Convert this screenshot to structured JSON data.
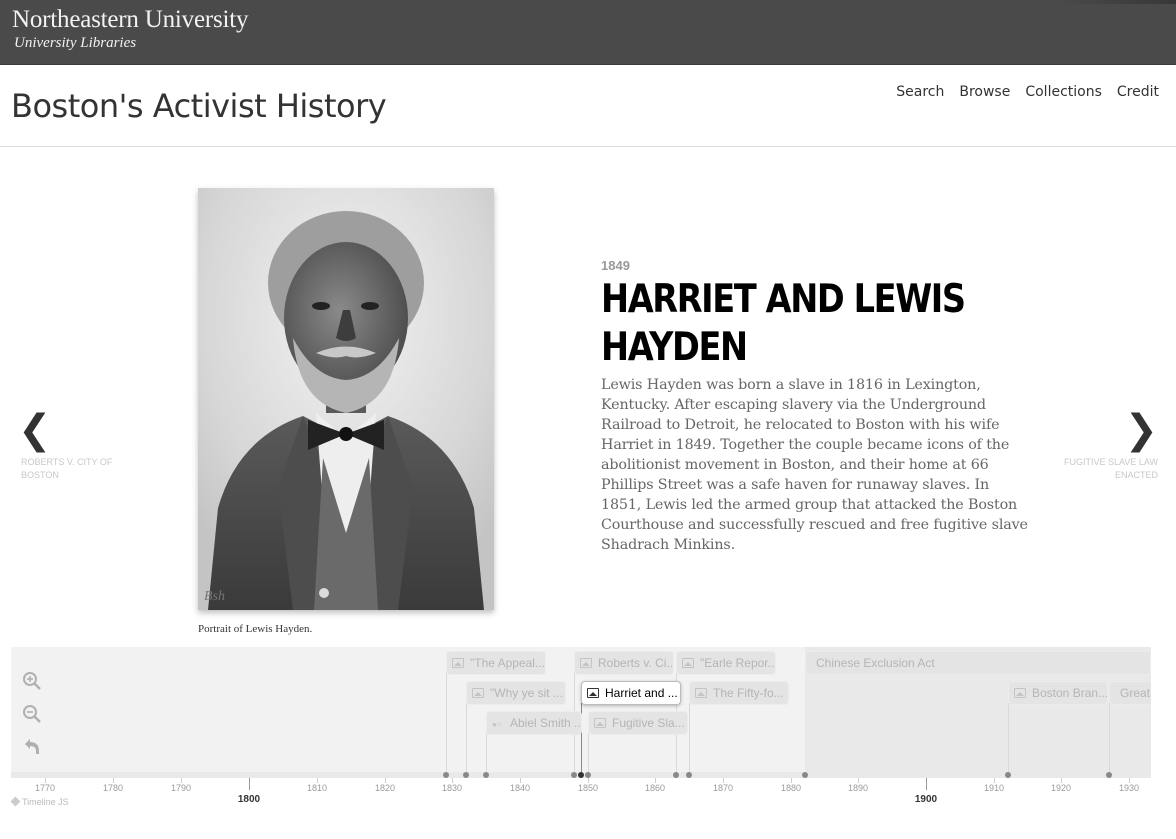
{
  "banner": {
    "university": "Northeastern University",
    "libraries": "University Libraries"
  },
  "header": {
    "site_title": "Boston's Activist History",
    "nav": [
      "Search",
      "Browse",
      "Collections",
      "Credit"
    ]
  },
  "slide": {
    "caption": "Portrait of Lewis Hayden.",
    "date": "1849",
    "headline": "Harriet and Lewis Hayden",
    "text": "Lewis Hayden was born a slave in 1816 in Lexington, Kentucky. After escaping slavery via the Underground Railroad to Detroit, he relocated to Boston with his wife Harriet in 1849. Together the couple became icons of the abolitionist movement in Boston, and their home at 66 Phillips Street was a safe haven for runaway slaves. In 1851, Lewis led the armed group that attacked the Boston Courthouse and successfully rescued and free fugitive slave Shadrach Minkins.",
    "prev_label": "Roberts v. City of Boston",
    "next_label": "Fugitive Slave Law Enacted"
  },
  "timeline": {
    "markers": [
      {
        "title": "\"The Appeal...",
        "icon": "image-icon",
        "active": false
      },
      {
        "title": "\"Why ye sit ...",
        "icon": "image-icon",
        "active": false
      },
      {
        "title": "Abiel Smith ...",
        "icon": "dots-icon",
        "active": false
      },
      {
        "title": "Roberts v. Ci...",
        "icon": "image-icon",
        "active": false
      },
      {
        "title": "Harriet and ...",
        "icon": "image-icon",
        "active": true
      },
      {
        "title": "Fugitive Sla...",
        "icon": "image-icon",
        "active": false
      },
      {
        "title": "\"Earle Repor...",
        "icon": "image-icon",
        "active": false
      },
      {
        "title": "The Fifty-fo...",
        "icon": "image-icon",
        "active": false
      },
      {
        "title": "Chinese Exclusion Act",
        "icon": "",
        "active": false
      },
      {
        "title": "Boston Bran...",
        "icon": "image-icon",
        "active": false
      },
      {
        "title": "Great",
        "icon": "",
        "active": false
      }
    ],
    "minor_ticks": [
      "1770",
      "1780",
      "1790",
      "1810",
      "1820",
      "1830",
      "1840",
      "1850",
      "1860",
      "1870",
      "1880",
      "1890",
      "1910",
      "1920",
      "1930"
    ],
    "major_ticks": [
      "1800",
      "1900"
    ],
    "attribution": "Timeline JS"
  },
  "controls": {
    "zoom_in": "zoom-in-icon",
    "zoom_out": "zoom-out-icon",
    "back": "back-icon"
  },
  "colors": {
    "banner": "#4a4a4a",
    "timeline_bg": "#f2f2f2",
    "headline": "#000000",
    "body_text": "#666666"
  }
}
